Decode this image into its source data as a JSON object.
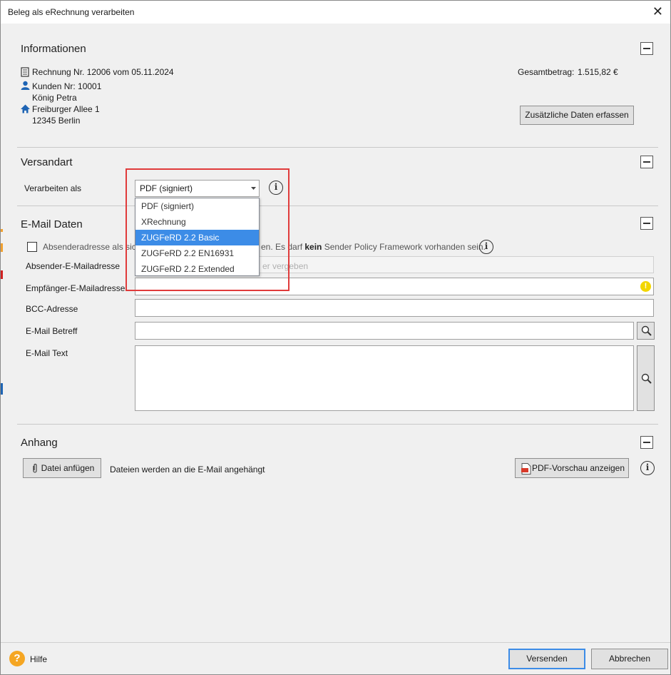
{
  "window": {
    "title": "Beleg als eRechnung verarbeiten"
  },
  "info": {
    "title": "Informationen",
    "invoice": "Rechnung Nr. 12006 vom 05.11.2024",
    "customer_no": "Kunden Nr: 10001",
    "customer_name": "König Petra",
    "street": "Freiburger Allee 1",
    "city": "12345 Berlin",
    "total_label": "Gesamtbetrag:",
    "total_value": "1.515,82 €",
    "extra_button": "Zusätzliche Daten erfassen"
  },
  "versand": {
    "title": "Versandart",
    "process_label": "Verarbeiten als",
    "selected": "PDF (signiert)",
    "options": [
      "PDF (signiert)",
      "XRechnung",
      "ZUGFeRD 2.2 Basic",
      "ZUGFeRD 2.2 EN16931",
      "ZUGFeRD 2.2 Extended"
    ],
    "highlighted": "ZUGFeRD 2.2 Basic"
  },
  "email": {
    "title": "E-Mail Daten",
    "checkbox_text_left": "Absenderadresse als sic",
    "checkbox_text_right_a": "en. Es darf ",
    "checkbox_text_bold": "kein",
    "checkbox_text_right_b": " Sender Policy Framework vorhanden sein.",
    "sender_label": "Absender-E-Mailadresse",
    "sender_placeholder": "er vergeben",
    "recipient_label": "Empfänger-E-Mailadresse",
    "bcc_label": "BCC-Adresse",
    "subject_label": "E-Mail Betreff",
    "text_label": "E-Mail Text"
  },
  "attachment": {
    "title": "Anhang",
    "attach_button": "Datei anfügen",
    "note": "Dateien werden an die E-Mail angehängt",
    "preview_button": "PDF-Vorschau anzeigen"
  },
  "footer": {
    "help": "Hilfe",
    "send": "Versenden",
    "cancel": "Abbrechen"
  },
  "colors": {
    "accent": "#3c8ce7",
    "highlight_box": "#e03b3b",
    "warning": "#f2d600",
    "icon_blue": "#1e64b4"
  }
}
